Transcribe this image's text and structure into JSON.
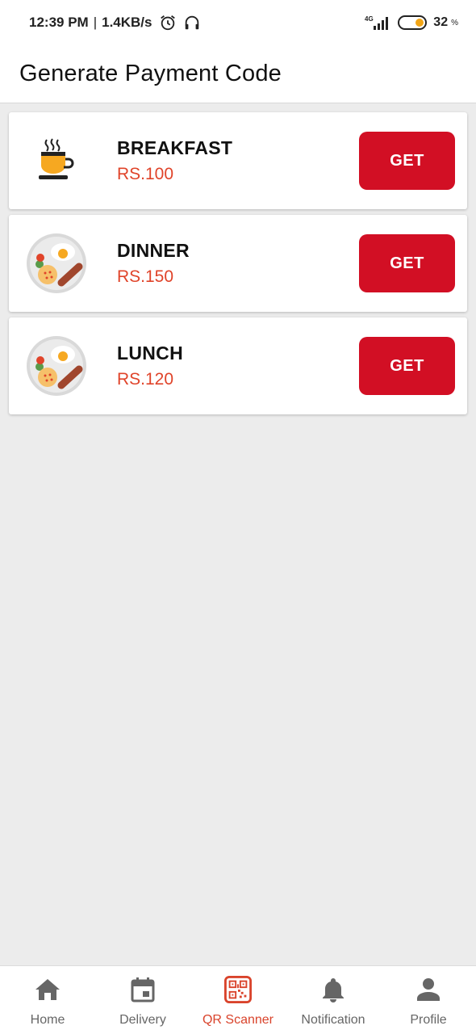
{
  "status_bar": {
    "time": "12:39 PM",
    "separator": "|",
    "network_speed": "1.4KB/s",
    "network_type": "4G",
    "battery_percent": "32",
    "battery_unit": "%"
  },
  "header": {
    "title": "Generate Payment Code"
  },
  "meals": [
    {
      "name": "BREAKFAST",
      "price": "RS.100",
      "button": "GET",
      "icon": "coffee-cup-icon"
    },
    {
      "name": "DINNER",
      "price": "RS.150",
      "button": "GET",
      "icon": "breakfast-plate-icon"
    },
    {
      "name": "LUNCH",
      "price": "RS.120",
      "button": "GET",
      "icon": "breakfast-plate-icon"
    }
  ],
  "bottom_nav": {
    "active_index": 2,
    "items": [
      {
        "label": "Home",
        "icon": "home-icon"
      },
      {
        "label": "Delivery",
        "icon": "calendar-icon"
      },
      {
        "label": "QR Scanner",
        "icon": "qr-code-icon"
      },
      {
        "label": "Notification",
        "icon": "bell-icon"
      },
      {
        "label": "Profile",
        "icon": "person-icon"
      }
    ]
  },
  "colors": {
    "accent_red": "#d20f24",
    "price_red": "#e0442a",
    "active_nav": "#d9432b",
    "background": "#ececec"
  }
}
